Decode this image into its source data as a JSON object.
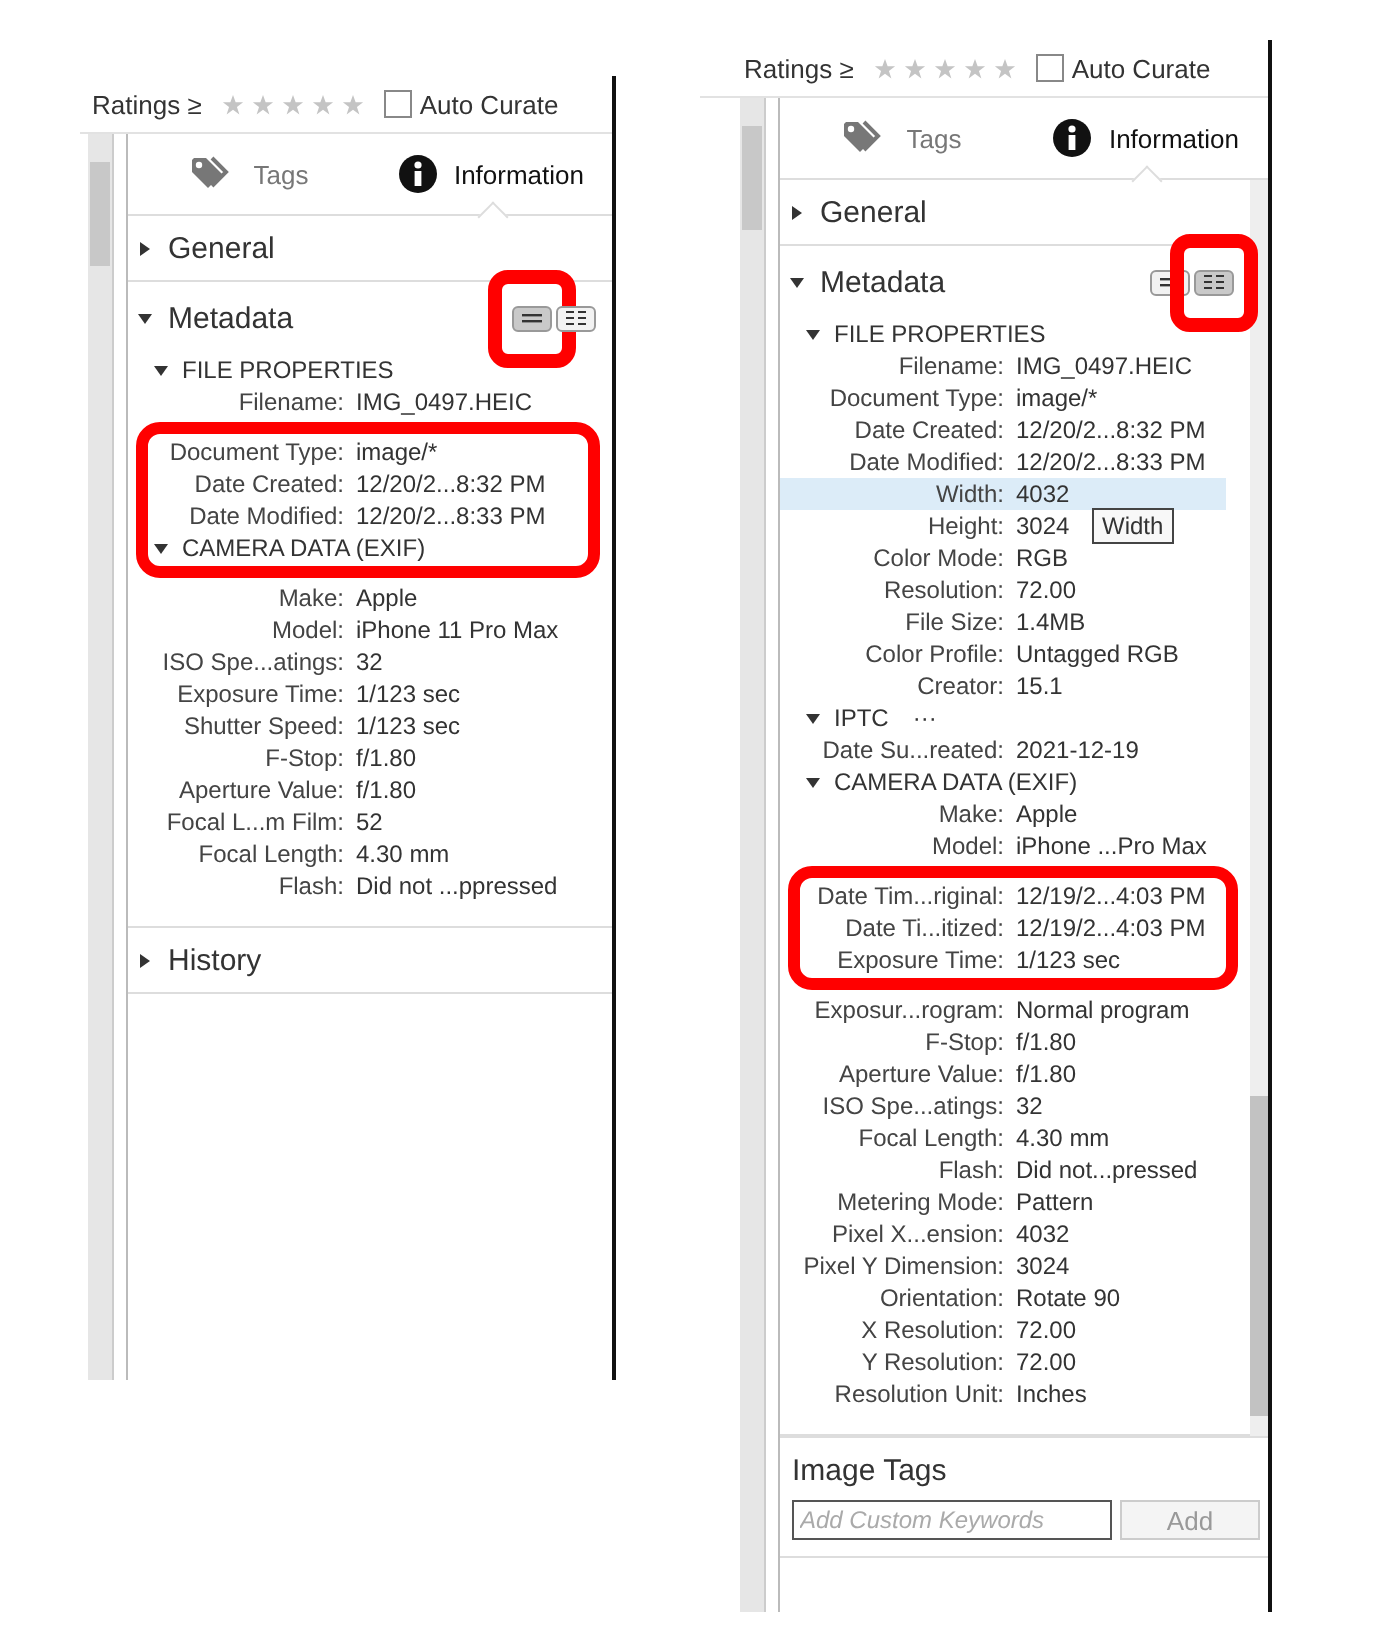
{
  "panels": [
    {
      "ratings_label": "Ratings ≥",
      "stars": 0,
      "auto_curate": {
        "label": "Auto Curate",
        "checked": false
      },
      "scrollable": false,
      "tabs": [
        {
          "kind": "tags",
          "label": "Tags",
          "selected": false
        },
        {
          "kind": "info",
          "label": "Information",
          "selected": true
        }
      ],
      "sections": [
        {
          "kind": "header",
          "title": "General",
          "expanded": false
        },
        {
          "kind": "metadata",
          "title": "Metadata",
          "expanded": true,
          "view_toggle": [
            {
              "kind": "compact",
              "selected": true,
              "outlined": true
            },
            {
              "kind": "detailed",
              "selected": false,
              "outlined": false
            }
          ],
          "entries": [
            {
              "kind": "group",
              "title": "FILE PROPERTIES",
              "expanded": true
            },
            {
              "kind": "row",
              "label": "Filename:",
              "value": "IMG_0497.HEIC",
              "selected": false
            },
            {
              "kind": "callout",
              "entries": [
                {
                  "kind": "row",
                  "label": "Document Type:",
                  "value": "image/*",
                  "selected": false
                },
                {
                  "kind": "row",
                  "label": "Date Created:",
                  "value": "12/20/2...8:32 PM",
                  "selected": false
                },
                {
                  "kind": "row",
                  "label": "Date Modified:",
                  "value": "12/20/2...8:33 PM",
                  "selected": false
                },
                {
                  "kind": "group",
                  "title": "CAMERA DATA (EXIF)",
                  "expanded": true
                }
              ]
            },
            {
              "kind": "row",
              "label": "Make:",
              "value": "Apple",
              "selected": false
            },
            {
              "kind": "row",
              "label": "Model:",
              "value": "iPhone 11 Pro Max",
              "selected": false
            },
            {
              "kind": "row",
              "label": "ISO Spe...atings:",
              "value": "32",
              "selected": false
            },
            {
              "kind": "row",
              "label": "Exposure Time:",
              "value": "1/123 sec",
              "selected": false
            },
            {
              "kind": "row",
              "label": "Shutter Speed:",
              "value": "1/123 sec",
              "selected": false
            },
            {
              "kind": "row",
              "label": "F-Stop:",
              "value": "f/1.80",
              "selected": false
            },
            {
              "kind": "row",
              "label": "Aperture Value:",
              "value": "f/1.80",
              "selected": false
            },
            {
              "kind": "row",
              "label": "Focal L...m Film:",
              "value": "52",
              "selected": false
            },
            {
              "kind": "row",
              "label": "Focal Length:",
              "value": "4.30 mm",
              "selected": false
            },
            {
              "kind": "row",
              "label": "Flash:",
              "value": "Did not ...ppressed",
              "selected": false
            }
          ]
        },
        {
          "kind": "header",
          "title": "History",
          "expanded": false
        }
      ]
    },
    {
      "ratings_label": "Ratings ≥",
      "stars": 0,
      "auto_curate": {
        "label": "Auto Curate",
        "checked": false
      },
      "scrollable": true,
      "tabs": [
        {
          "kind": "tags",
          "label": "Tags",
          "selected": false
        },
        {
          "kind": "info",
          "label": "Information",
          "selected": true
        }
      ],
      "sections": [
        {
          "kind": "header",
          "title": "General",
          "expanded": false
        },
        {
          "kind": "metadata",
          "title": "Metadata",
          "expanded": true,
          "tooltip": "Width",
          "view_toggle": [
            {
              "kind": "compact",
              "selected": false,
              "outlined": false
            },
            {
              "kind": "detailed",
              "selected": true,
              "outlined": true
            }
          ],
          "entries": [
            {
              "kind": "group",
              "title": "FILE PROPERTIES",
              "expanded": true
            },
            {
              "kind": "row",
              "label": "Filename:",
              "value": "IMG_0497.HEIC",
              "selected": false
            },
            {
              "kind": "row",
              "label": "Document Type:",
              "value": "image/*",
              "selected": false
            },
            {
              "kind": "row",
              "label": "Date Created:",
              "value": "12/20/2...8:32 PM",
              "selected": false
            },
            {
              "kind": "row",
              "label": "Date Modified:",
              "value": "12/20/2...8:33 PM",
              "selected": false
            },
            {
              "kind": "row",
              "label": "Width:",
              "value": "4032",
              "selected": true
            },
            {
              "kind": "row",
              "label": "Height:",
              "value": "3024",
              "selected": false
            },
            {
              "kind": "row",
              "label": "Color Mode:",
              "value": "RGB",
              "selected": false
            },
            {
              "kind": "row",
              "label": "Resolution:",
              "value": "72.00",
              "selected": false
            },
            {
              "kind": "row",
              "label": "File Size:",
              "value": "1.4MB",
              "selected": false
            },
            {
              "kind": "row",
              "label": "Color Profile:",
              "value": "Untagged RGB",
              "selected": false
            },
            {
              "kind": "row",
              "label": "Creator:",
              "value": "15.1",
              "selected": false
            },
            {
              "kind": "group",
              "title": "IPTC",
              "expanded": true,
              "extra": "···"
            },
            {
              "kind": "row",
              "label": "Date Su...reated:",
              "value": "2021-12-19",
              "selected": false
            },
            {
              "kind": "group",
              "title": "CAMERA DATA (EXIF)",
              "expanded": true
            },
            {
              "kind": "row",
              "label": "Make:",
              "value": "Apple",
              "selected": false
            },
            {
              "kind": "row",
              "label": "Model:",
              "value": "iPhone ...Pro Max",
              "selected": false
            },
            {
              "kind": "callout",
              "entries": [
                {
                  "kind": "row",
                  "label": "Date Tim...riginal:",
                  "value": "12/19/2...4:03 PM",
                  "selected": false
                },
                {
                  "kind": "row",
                  "label": "Date Ti...itized:",
                  "value": "12/19/2...4:03 PM",
                  "selected": false
                },
                {
                  "kind": "row",
                  "label": "Exposure Time:",
                  "value": "1/123 sec",
                  "selected": false
                }
              ]
            },
            {
              "kind": "row",
              "label": "Exposur...rogram:",
              "value": "Normal program",
              "selected": false
            },
            {
              "kind": "row",
              "label": "F-Stop:",
              "value": "f/1.80",
              "selected": false
            },
            {
              "kind": "row",
              "label": "Aperture Value:",
              "value": "f/1.80",
              "selected": false
            },
            {
              "kind": "row",
              "label": "ISO Spe...atings:",
              "value": "32",
              "selected": false
            },
            {
              "kind": "row",
              "label": "Focal Length:",
              "value": "4.30 mm",
              "selected": false
            },
            {
              "kind": "row",
              "label": "Flash:",
              "value": "Did not...pressed",
              "selected": false
            },
            {
              "kind": "row",
              "label": "Metering Mode:",
              "value": "Pattern",
              "selected": false
            },
            {
              "kind": "row",
              "label": "Pixel X...ension:",
              "value": "4032",
              "selected": false
            },
            {
              "kind": "row",
              "label": "Pixel Y Dimension:",
              "value": "3024",
              "selected": false
            },
            {
              "kind": "row",
              "label": "Orientation:",
              "value": "Rotate 90",
              "selected": false
            },
            {
              "kind": "row",
              "label": "X Resolution:",
              "value": "72.00",
              "selected": false
            },
            {
              "kind": "row",
              "label": "Y Resolution:",
              "value": "72.00",
              "selected": false
            },
            {
              "kind": "row",
              "label": "Resolution Unit:",
              "value": "Inches",
              "selected": false
            }
          ]
        },
        {
          "kind": "tags",
          "title": "Image Tags",
          "placeholder": "Add Custom Keywords",
          "button": {
            "label": "Add",
            "disabled": true
          }
        }
      ]
    }
  ]
}
